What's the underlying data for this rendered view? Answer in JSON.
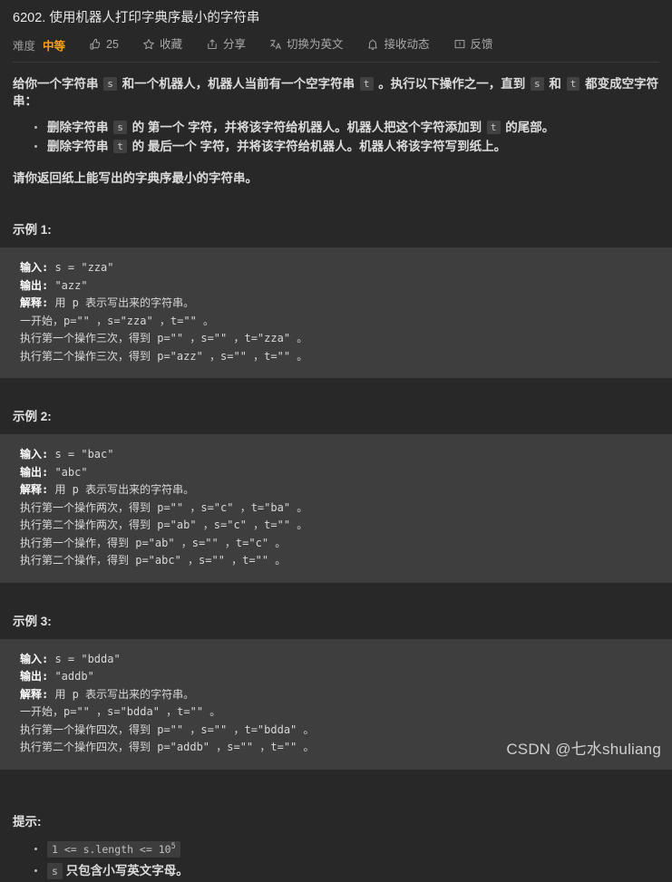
{
  "header": {
    "title": "6202. 使用机器人打印字典序最小的字符串",
    "difficulty_label": "难度",
    "difficulty_value": "中等",
    "difficulty_color": "#ffa116",
    "toolbar": [
      {
        "icon": "thumbs-up-icon",
        "label": "25"
      },
      {
        "icon": "star-icon",
        "label": "收藏"
      },
      {
        "icon": "share-icon",
        "label": "分享"
      },
      {
        "icon": "translate-icon",
        "label": "切换为英文"
      },
      {
        "icon": "bell-icon",
        "label": "接收动态"
      },
      {
        "icon": "feedback-icon",
        "label": "反馈"
      }
    ]
  },
  "description": {
    "intro_parts": [
      {
        "t": "text",
        "v": "给你一个字符串 "
      },
      {
        "t": "code",
        "v": "s"
      },
      {
        "t": "text",
        "v": " 和一个机器人，机器人当前有一个空字符串 "
      },
      {
        "t": "code",
        "v": "t"
      },
      {
        "t": "text",
        "v": " 。执行以下操作之一，直到 "
      },
      {
        "t": "code",
        "v": "s"
      },
      {
        "t": "text",
        "v": " 和 "
      },
      {
        "t": "code",
        "v": "t"
      },
      {
        "t": "text",
        "v": " 都变成空字符串："
      }
    ],
    "operations": [
      [
        {
          "t": "text",
          "v": "删除字符串 "
        },
        {
          "t": "code",
          "v": "s"
        },
        {
          "t": "text",
          "v": " 的 第一个 字符，并将该字符给机器人。机器人把这个字符添加到 "
        },
        {
          "t": "code",
          "v": "t"
        },
        {
          "t": "text",
          "v": " 的尾部。"
        }
      ],
      [
        {
          "t": "text",
          "v": "删除字符串 "
        },
        {
          "t": "code",
          "v": "t"
        },
        {
          "t": "text",
          "v": " 的 最后一个 字符，并将该字符给机器人。机器人将该字符写到纸上。"
        }
      ]
    ],
    "closing": "请你返回纸上能写出的字典序最小的字符串。"
  },
  "examples": [
    {
      "title": "示例 1:",
      "lines": [
        {
          "label": "输入:",
          "rest": " s = \"zza\""
        },
        {
          "label": "输出:",
          "rest": " \"azz\""
        },
        {
          "label": "解释:",
          "rest": " 用 p 表示写出来的字符串。"
        },
        {
          "label": "",
          "rest": "一开始，p=\"\" ，s=\"zza\" ，t=\"\" 。"
        },
        {
          "label": "",
          "rest": "执行第一个操作三次，得到 p=\"\" ，s=\"\" ，t=\"zza\" 。"
        },
        {
          "label": "",
          "rest": "执行第二个操作三次，得到 p=\"azz\" ，s=\"\" ，t=\"\" 。"
        }
      ]
    },
    {
      "title": "示例 2:",
      "lines": [
        {
          "label": "输入:",
          "rest": " s = \"bac\""
        },
        {
          "label": "输出:",
          "rest": " \"abc\""
        },
        {
          "label": "解释:",
          "rest": " 用 p 表示写出来的字符串。"
        },
        {
          "label": "",
          "rest": "执行第一个操作两次，得到 p=\"\" ，s=\"c\" ，t=\"ba\" 。"
        },
        {
          "label": "",
          "rest": "执行第二个操作两次，得到 p=\"ab\" ，s=\"c\" ，t=\"\" 。"
        },
        {
          "label": "",
          "rest": "执行第一个操作，得到 p=\"ab\" ，s=\"\" ，t=\"c\" 。"
        },
        {
          "label": "",
          "rest": "执行第二个操作，得到 p=\"abc\" ，s=\"\" ，t=\"\" 。"
        }
      ]
    },
    {
      "title": "示例 3:",
      "lines": [
        {
          "label": "输入:",
          "rest": " s = \"bdda\""
        },
        {
          "label": "输出:",
          "rest": " \"addb\""
        },
        {
          "label": "解释:",
          "rest": " 用 p 表示写出来的字符串。"
        },
        {
          "label": "",
          "rest": "一开始，p=\"\" ，s=\"bdda\" ，t=\"\" 。"
        },
        {
          "label": "",
          "rest": "执行第一个操作四次，得到 p=\"\" ，s=\"\" ，t=\"bdda\" 。"
        },
        {
          "label": "",
          "rest": "执行第二个操作四次，得到 p=\"addb\" ，s=\"\" ，t=\"\" 。"
        }
      ]
    }
  ],
  "hints": {
    "title": "提示:",
    "items": [
      [
        {
          "t": "hintcode",
          "v": "1 <= s.length <= 10",
          "sup": "5"
        }
      ],
      [
        {
          "t": "hintcode",
          "v": "s"
        },
        {
          "t": "text",
          "v": " 只包含小写英文字母。"
        }
      ]
    ]
  },
  "watermark": "CSDN @七水shuliang"
}
